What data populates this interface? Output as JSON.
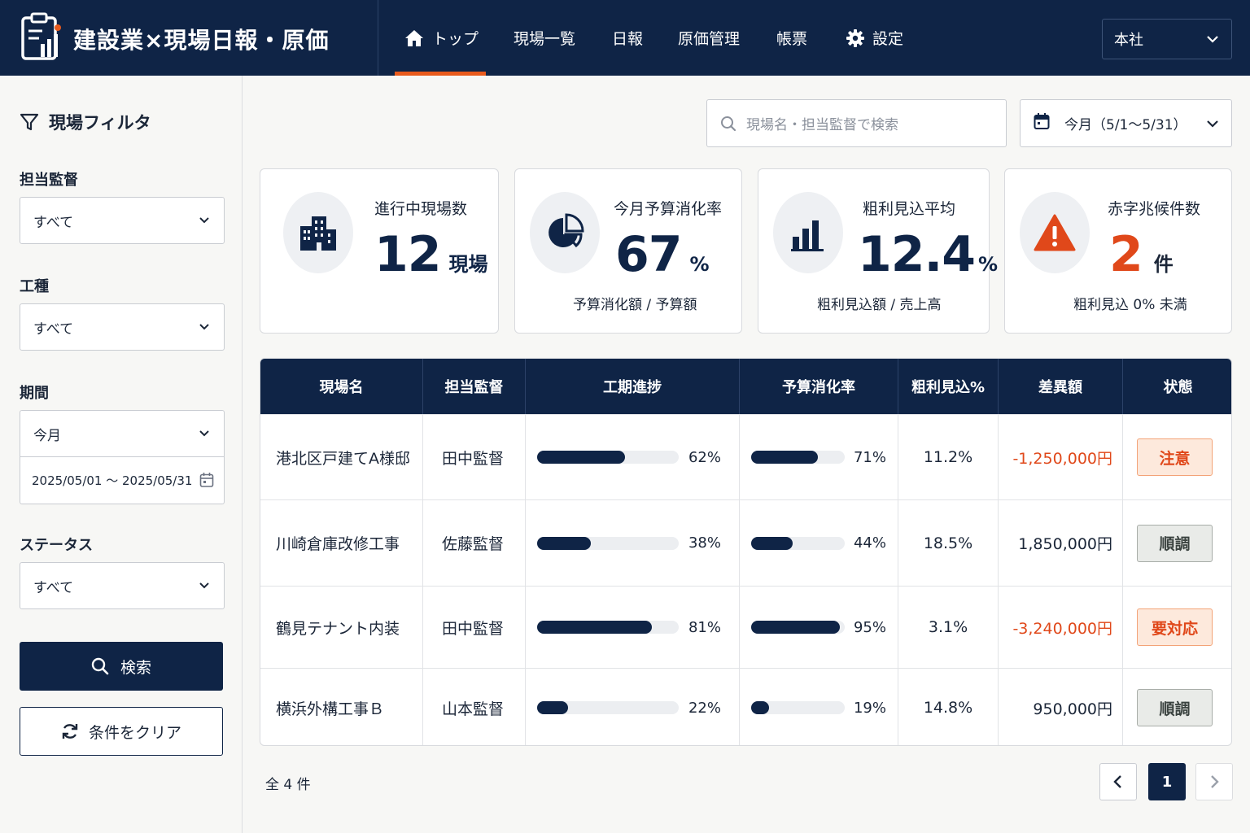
{
  "app": {
    "title": "建設業×現場日報・原価"
  },
  "nav": {
    "items": [
      {
        "label": "トップ",
        "icon": "home-icon",
        "active": true
      },
      {
        "label": "現場一覧"
      },
      {
        "label": "日報"
      },
      {
        "label": "原価管理"
      },
      {
        "label": "帳票"
      },
      {
        "label": "設定",
        "icon": "gear-icon"
      }
    ],
    "branch": "本社"
  },
  "sidebar": {
    "title": "現場フィルタ",
    "supervisor": {
      "label": "担当監督",
      "value": "すべて"
    },
    "work_type": {
      "label": "工種",
      "value": "すべて"
    },
    "period": {
      "label": "期間",
      "value": "今月",
      "range": "2025/05/01 ～ 2025/05/31"
    },
    "status": {
      "label": "ステータス",
      "value": "すべて"
    },
    "search_button": "検索",
    "clear_button": "条件をクリア"
  },
  "toolbar": {
    "search_placeholder": "現場名・担当監督で検索",
    "period_value": "今月（5/1～5/31）"
  },
  "kpis": [
    {
      "title": "進行中現場数",
      "value": "12",
      "unit": "現場",
      "sub": "",
      "icon": "building-icon"
    },
    {
      "title": "今月予算消化率",
      "value": "67",
      "unit": "%",
      "sub": "予算消化額 / 予算額",
      "icon": "pie-chart-icon"
    },
    {
      "title": "粗利見込平均",
      "value": "12.4",
      "unit": "%",
      "sub": "粗利見込額 / 売上高",
      "icon": "bar-chart-icon"
    },
    {
      "title": "赤字兆候件数",
      "value": "2",
      "unit": "件",
      "sub": "粗利見込 0% 未満",
      "icon": "warning-icon",
      "color": "#e0481a"
    }
  ],
  "table": {
    "headers": [
      "現場名",
      "担当監督",
      "工期進捗",
      "予算消化率",
      "粗利見込%",
      "差異額",
      "状態"
    ],
    "rows": [
      {
        "site": "港北区戸建てA様邸",
        "supervisor": "田中監督",
        "progress": 62,
        "progress_label": "62%",
        "budget": 71,
        "budget_label": "71%",
        "margin": "11.2%",
        "variance": "-1,250,000円",
        "status": "注意"
      },
      {
        "site": "川崎倉庫改修工事",
        "supervisor": "佐藤監督",
        "progress": 38,
        "progress_label": "38%",
        "budget": 44,
        "budget_label": "44%",
        "margin": "18.5%",
        "variance": "1,850,000円",
        "status": "順調"
      },
      {
        "site": "鶴見テナント内装",
        "supervisor": "田中監督",
        "progress": 81,
        "progress_label": "81%",
        "budget": 95,
        "budget_label": "95%",
        "margin": "3.1%",
        "variance": "-3,240,000円",
        "status": "要対応"
      },
      {
        "site": "横浜外構工事Ｂ",
        "supervisor": "山本監督",
        "progress": 22,
        "progress_label": "22%",
        "budget": 19,
        "budget_label": "19%",
        "margin": "14.8%",
        "variance": "950,000円",
        "status": "順調"
      }
    ]
  },
  "footer": {
    "total": "全 4 件",
    "current_page": "1"
  },
  "colors": {
    "navy": "#0f2446",
    "accent": "#e85a1c",
    "danger": "#e0481a"
  }
}
